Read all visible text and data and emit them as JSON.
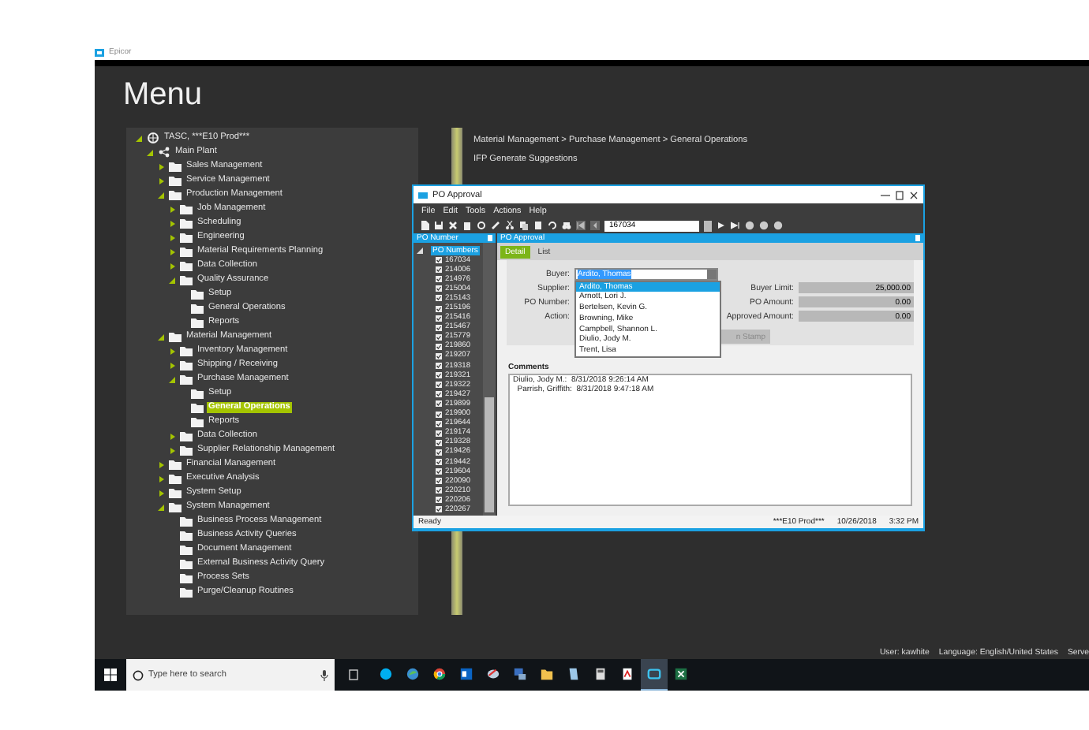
{
  "app": {
    "title": "Epicor",
    "heading": "Menu"
  },
  "tree": [
    {
      "label": "TASC, ***E10 Prod***",
      "kind": "company",
      "expanded": true,
      "selected": false,
      "children": [
        {
          "label": "Main Plant",
          "kind": "site",
          "expanded": true,
          "selected": false,
          "children": [
            {
              "label": "Sales Management",
              "kind": "folder",
              "expanded": false,
              "selected": false
            },
            {
              "label": "Service Management",
              "kind": "folder",
              "expanded": false,
              "selected": false
            },
            {
              "label": "Production Management",
              "kind": "folder",
              "expanded": true,
              "selected": false,
              "children": [
                {
                  "label": "Job Management",
                  "kind": "folder",
                  "expanded": false,
                  "selected": false
                },
                {
                  "label": "Scheduling",
                  "kind": "folder",
                  "expanded": false,
                  "selected": false
                },
                {
                  "label": "Engineering",
                  "kind": "folder",
                  "expanded": false,
                  "selected": false
                },
                {
                  "label": "Material Requirements Planning",
                  "kind": "folder",
                  "expanded": false,
                  "selected": false
                },
                {
                  "label": "Data Collection",
                  "kind": "folder",
                  "expanded": false,
                  "selected": false
                },
                {
                  "label": "Quality Assurance",
                  "kind": "folder",
                  "expanded": true,
                  "selected": false,
                  "children": [
                    {
                      "label": "Setup",
                      "kind": "folder",
                      "selected": false
                    },
                    {
                      "label": "General Operations",
                      "kind": "folder",
                      "selected": false
                    },
                    {
                      "label": "Reports",
                      "kind": "folder",
                      "selected": false
                    }
                  ]
                }
              ]
            },
            {
              "label": "Material Management",
              "kind": "folder",
              "expanded": true,
              "selected": false,
              "children": [
                {
                  "label": "Inventory Management",
                  "kind": "folder",
                  "expanded": false,
                  "selected": false
                },
                {
                  "label": "Shipping / Receiving",
                  "kind": "folder",
                  "expanded": false,
                  "selected": false
                },
                {
                  "label": "Purchase Management",
                  "kind": "folder",
                  "expanded": true,
                  "selected": false,
                  "children": [
                    {
                      "label": "Setup",
                      "kind": "folder",
                      "selected": false
                    },
                    {
                      "label": "General Operations",
                      "kind": "folder",
                      "selected": true
                    },
                    {
                      "label": "Reports",
                      "kind": "folder",
                      "selected": false
                    }
                  ]
                },
                {
                  "label": "Data Collection",
                  "kind": "folder",
                  "expanded": false,
                  "selected": false
                },
                {
                  "label": "Supplier Relationship Management",
                  "kind": "folder",
                  "expanded": false,
                  "selected": false
                }
              ]
            },
            {
              "label": "Financial Management",
              "kind": "folder",
              "expanded": false,
              "selected": false
            },
            {
              "label": "Executive Analysis",
              "kind": "folder",
              "expanded": false,
              "selected": false
            },
            {
              "label": "System Setup",
              "kind": "folder",
              "expanded": false,
              "selected": false
            },
            {
              "label": "System Management",
              "kind": "folder",
              "expanded": true,
              "selected": false,
              "children": [
                {
                  "label": "Business Process Management",
                  "kind": "folder",
                  "selected": false
                },
                {
                  "label": "Business Activity Queries",
                  "kind": "folder",
                  "selected": false
                },
                {
                  "label": "Document Management",
                  "kind": "folder",
                  "selected": false
                },
                {
                  "label": "External Business Activity Query",
                  "kind": "folder",
                  "selected": false
                },
                {
                  "label": "Process Sets",
                  "kind": "folder",
                  "selected": false
                },
                {
                  "label": "Purge/Cleanup Routines",
                  "kind": "folder",
                  "selected": false
                }
              ]
            }
          ]
        }
      ]
    }
  ],
  "breadcrumb": "Material Management > Purchase Management > General Operations",
  "shortcut": "IFP Generate Suggestions",
  "po_window": {
    "title": "PO Approval",
    "menu": [
      "File",
      "Edit",
      "Tools",
      "Actions",
      "Help"
    ],
    "search_value": "167034",
    "left_panel": {
      "title": "PO Number",
      "root": {
        "label": "PO Numbers",
        "selected": true
      },
      "items": [
        "167034",
        "214006",
        "214976",
        "215004",
        "215143",
        "215196",
        "215416",
        "215467",
        "215779",
        "219860",
        "219207",
        "219318",
        "219321",
        "219322",
        "219427",
        "219899",
        "219900",
        "219644",
        "219174",
        "219328",
        "219426",
        "219442",
        "219604",
        "220090",
        "220210",
        "220206",
        "220267"
      ]
    },
    "right_panel": {
      "title": "PO Approval"
    },
    "tabs": [
      {
        "label": "Detail",
        "selected": true
      },
      {
        "label": "List",
        "selected": false
      }
    ],
    "buyer": {
      "label": "Buyer:",
      "value": "Ardito, Thomas"
    },
    "supplier": {
      "label": "Supplier:"
    },
    "po_number": {
      "label": "PO Number:"
    },
    "action": {
      "label": "Action:"
    },
    "buyer_limit": {
      "label": "Buyer Limit:",
      "value": "25,000.00"
    },
    "po_amount": {
      "label": "PO Amount:",
      "value": "0.00"
    },
    "approved_amount": {
      "label": "Approved Amount:",
      "value": "0.00"
    },
    "stamp_button": {
      "label": "n Stamp",
      "disabled": true
    },
    "buyer_options": [
      {
        "label": "Ardito, Thomas",
        "selected": true
      },
      {
        "label": "Arnott, Lori J.",
        "selected": false
      },
      {
        "label": "Bertelsen, Kevin G.",
        "selected": false
      },
      {
        "label": "Browning, Mike",
        "selected": false
      },
      {
        "label": "Campbell, Shannon L.",
        "selected": false
      },
      {
        "label": "Diulio, Jody M.",
        "selected": false
      },
      {
        "label": "Trent, Lisa",
        "selected": false
      }
    ],
    "comments": {
      "label": "Comments",
      "lines": [
        "Diulio, Jody M.:  8/31/2018 9:26:14 AM",
        "  Parrish, Griffith:  8/31/2018 9:47:18 AM"
      ]
    },
    "status_bar": {
      "message": "Ready",
      "environment": "***E10 Prod***",
      "date": "10/26/2018",
      "time": "3:32 PM"
    }
  },
  "status_line": [
    "User:  kawhite",
    "Language:  English/United States",
    "Serve"
  ],
  "taskbar": {
    "search_placeholder": "Type here to search",
    "apps": [
      {
        "active": false
      },
      {
        "active": false
      },
      {
        "active": false
      },
      {
        "active": false
      },
      {
        "active": false
      },
      {
        "active": false
      },
      {
        "active": false
      },
      {
        "active": false
      },
      {
        "active": false
      },
      {
        "active": false
      },
      {
        "active": true
      },
      {
        "active": false
      }
    ]
  }
}
